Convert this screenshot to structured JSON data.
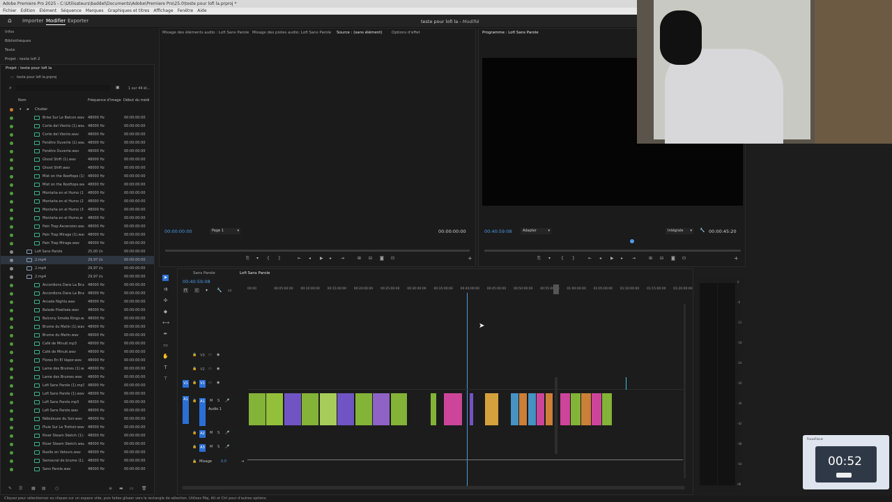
{
  "window": {
    "title": "Adobe Premiere Pro 2025 - C:\\Utilisateurs\\baddel\\Documents\\Adobe\\Premiere Pro\\25.0\\teste pour lofi la.prproj *",
    "doc_title": "teste pour lofi la",
    "doc_status": "Modifié"
  },
  "menu": [
    "Fichier",
    "Edition",
    "Elément",
    "Séquence",
    "Marques",
    "Graphiques et titres",
    "Affichage",
    "Fenêtre",
    "Aide"
  ],
  "header_tabs": [
    "Importer",
    "Modifier",
    "Exporter"
  ],
  "left_nav": [
    "Infos",
    "Bibliothèques",
    "Texte",
    "Projet : teste lofi 2"
  ],
  "project": {
    "tab": "Projet : teste pour lofi la",
    "file": "teste pour lofi la.prproj",
    "count": "1 sur 44 él...",
    "columns": {
      "name": "Nom",
      "rate": "Fréquence d'image",
      "start": "Début du médi"
    },
    "folder": "Chutier",
    "items": [
      {
        "name": "Brise Sur Le Balcon.wav",
        "rate": "48000  Hz",
        "start": "00:00:00:00"
      },
      {
        "name": "Corte del Viento (1).wav",
        "rate": "48000  Hz",
        "start": "00:00:00:00"
      },
      {
        "name": "Corte del Viento.wav",
        "rate": "48000  Hz",
        "start": "00:00:00:00"
      },
      {
        "name": "Fenêtre Ouverte (1).wav",
        "rate": "48000  Hz",
        "start": "00:00:00:00"
      },
      {
        "name": "Fenêtre Ouverte.wav",
        "rate": "48000  Hz",
        "start": "00:00:00:00"
      },
      {
        "name": "Ghost Shift (1).wav",
        "rate": "48000  Hz",
        "start": "00:00:00:00"
      },
      {
        "name": "Ghost Shift.wav",
        "rate": "48000  Hz",
        "start": "00:00:00:00"
      },
      {
        "name": "Mist on the Rooftops (1)",
        "rate": "48000  Hz",
        "start": "00:00:00:00"
      },
      {
        "name": "Mist on the Rooftops.wa",
        "rate": "48000  Hz",
        "start": "00:00:00:00"
      },
      {
        "name": "Montaña en el Humo (1",
        "rate": "48000  Hz",
        "start": "00:00:00:00"
      },
      {
        "name": "Montaña en el Humo (2",
        "rate": "48000  Hz",
        "start": "00:00:00:00"
      },
      {
        "name": "Montaña en el Humo (3",
        "rate": "48000  Hz",
        "start": "00:00:00:00"
      },
      {
        "name": "Montaña en el Humo.w",
        "rate": "48000  Hz",
        "start": "00:00:00:00"
      },
      {
        "name": "Pain Trap Ascension.wav",
        "rate": "48000  Hz",
        "start": "00:00:00:00"
      },
      {
        "name": "Pain Trap Mirage (1).wav",
        "rate": "48000  Hz",
        "start": "00:00:00:00"
      },
      {
        "name": "Pain Trap Mirage.wav",
        "rate": "48000  Hz",
        "start": "00:00:00:00"
      },
      {
        "name": "Lofi Sans Parole",
        "rate": "25,00 i/s",
        "start": "00:00:00:00"
      },
      {
        "name": "2.mp4",
        "rate": "29,97 i/s",
        "start": "00:00:00:00"
      },
      {
        "name": "2.mp4",
        "rate": "29,97 i/s",
        "start": "00:00:00:00"
      },
      {
        "name": "2.mp4",
        "rate": "29,97 i/s",
        "start": "00:00:00:00"
      },
      {
        "name": "Accordions Dans La Brume (",
        "rate": "48000  Hz",
        "start": "00:00:00:00"
      },
      {
        "name": "Accordions Dans La Brume",
        "rate": "48000  Hz",
        "start": "00:00:00:00"
      },
      {
        "name": "Arcade Nights.wav",
        "rate": "48000  Hz",
        "start": "00:00:00:00"
      },
      {
        "name": "Balade Pixelisée.wav",
        "rate": "48000  Hz",
        "start": "00:00:00:00"
      },
      {
        "name": "Balcony Smoke Rings.wav",
        "rate": "48000  Hz",
        "start": "00:00:00:00"
      },
      {
        "name": "Brume du Matin (1).wav",
        "rate": "48000  Hz",
        "start": "00:00:00:00"
      },
      {
        "name": "Brume du Matin.wav",
        "rate": "48000  Hz",
        "start": "00:00:00:00"
      },
      {
        "name": "Café de Minuit.mp3",
        "rate": "48000  Hz",
        "start": "00:00:00:00"
      },
      {
        "name": "Café de Minuit.wav",
        "rate": "48000  Hz",
        "start": "00:00:00:00"
      },
      {
        "name": "Flores En El Vapor.wav",
        "rate": "48000  Hz",
        "start": "00:00:00:00"
      },
      {
        "name": "Lame des Brumes (1).wav",
        "rate": "48000  Hz",
        "start": "00:00:00:00"
      },
      {
        "name": "Lame des Brumes.wav",
        "rate": "48000  Hz",
        "start": "00:00:00:00"
      },
      {
        "name": "Lofi Sans Parole (1).mp3",
        "rate": "48000  Hz",
        "start": "00:00:00:00"
      },
      {
        "name": "Lofi Sans Parole (1).wav",
        "rate": "48000  Hz",
        "start": "00:00:00:00"
      },
      {
        "name": "Lofi Sans Parole.mp3",
        "rate": "48000  Hz",
        "start": "00:00:00:00"
      },
      {
        "name": "Lofi Sans Parole.wav",
        "rate": "48000  Hz",
        "start": "00:00:00:00"
      },
      {
        "name": "Nébuleuse du Soir.wav",
        "rate": "48000  Hz",
        "start": "00:00:00:00"
      },
      {
        "name": "Pluie Sur Le Trottoir.wav",
        "rate": "48000  Hz",
        "start": "00:00:00:00"
      },
      {
        "name": "River Steam Sketch (1).wav",
        "rate": "48000  Hz",
        "start": "00:00:00:00"
      },
      {
        "name": "River Steam Sketch.wav",
        "rate": "48000  Hz",
        "start": "00:00:00:00"
      },
      {
        "name": "Ruelle en Velours.wav",
        "rate": "48000  Hz",
        "start": "00:00:00:00"
      },
      {
        "name": "Samouraï de brume (1).wav",
        "rate": "48000  Hz",
        "start": "00:00:00:00"
      },
      {
        "name": "Sans Parole.wav",
        "rate": "48000  Hz",
        "start": "00:00:00:00"
      }
    ]
  },
  "source_tabs": [
    "Mixage des éléments audio : Lofi Sans Parole",
    "Mixage des pistes audio: Lofi Sans Parole",
    "Source : (sans élément)",
    "Options d'effet"
  ],
  "source": {
    "tc_left": "00:00:00:00",
    "page": "Page 1",
    "tc_right": "00:00:00:00"
  },
  "program": {
    "tab": "Programme : Lofi Sans Parole",
    "tc_left": "00:40:59:08",
    "fit": "Adapter",
    "quality": "Intégrale",
    "tc_right": "00:00:45:20"
  },
  "timeline": {
    "tabs": [
      "Sans Parole",
      "Lofi Sans Parole"
    ],
    "timecode": "00:40:59:08",
    "ruler": [
      "00:00",
      "00:05:00:00",
      "00:10:00:00",
      "00:15:00:00",
      "00:20:00:00",
      "00:25:00:00",
      "00:30:00:00",
      "00:35:00:00",
      "00:40:00:00",
      "00:45:00:00",
      "00:50:00:00",
      "00:55:00:00",
      "01:00:00:00",
      "01:05:00:00",
      "01:10:00:00",
      "01:15:00:00",
      "01:20:00:00"
    ],
    "video_tracks": [
      "V3",
      "V2",
      "V1"
    ],
    "audio_tracks": [
      "A1",
      "A2",
      "A3"
    ],
    "audio1_label": "Audio 1",
    "mix_label": "Mixage",
    "mix_value": "0,0"
  },
  "meter_scale": [
    "0",
    "-6",
    "-12",
    "-18",
    "-24",
    "-30",
    "-36",
    "-42",
    "-48",
    "-54",
    "dB"
  ],
  "status_bar": "Cliquez pour sélectionner ou cliquez sur un espace vide, puis faites glisser vers le rectangle de sélection. Utilisez Maj, Alt et Ctrl pour d'autres options.",
  "widget": {
    "time": "00:52",
    "title": "FocusFocus"
  },
  "colors": {
    "accent": "#2a6fd6",
    "timecode": "#4d9ae8",
    "clip_green": "#8fc43a",
    "clip_purple": "#7a5bd6",
    "clip_pink": "#e04aa8",
    "clip_orange": "#e08a3a"
  }
}
